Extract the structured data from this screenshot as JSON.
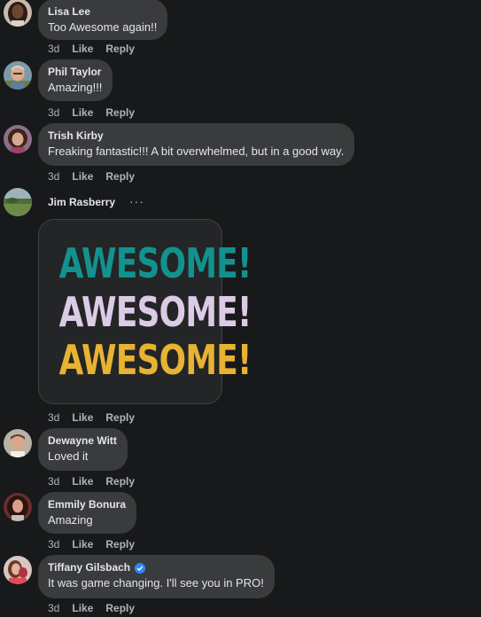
{
  "colors": {
    "background": "#18191a",
    "bubble": "#3a3b3c",
    "meta_text": "#b0b3b8",
    "verified_badge": "#2d88ff",
    "sticker_teal": "#12928f",
    "sticker_lavender": "#dccbe6",
    "sticker_gold": "#e8b232"
  },
  "comments": [
    {
      "author": "Lisa Lee",
      "text": "Too Awesome again!!",
      "time": "3d",
      "like": "Like",
      "reply": "Reply"
    },
    {
      "author": "Phil Taylor",
      "text": "Amazing!!!",
      "time": "3d",
      "like": "Like",
      "reply": "Reply"
    },
    {
      "author": "Trish Kirby",
      "text": "Freaking fantastic!!! A bit overwhelmed, but in a good way.",
      "time": "3d",
      "like": "Like",
      "reply": "Reply"
    },
    {
      "author": "Jim Rasberry",
      "more": "···",
      "sticker": [
        "AWESOME!",
        "AWESOME!",
        "AWESOME!"
      ],
      "time": "3d",
      "like": "Like",
      "reply": "Reply"
    },
    {
      "author": "Dewayne Witt",
      "text": "Loved it",
      "time": "3d",
      "like": "Like",
      "reply": "Reply"
    },
    {
      "author": "Emmily Bonura",
      "text": "Amazing",
      "time": "3d",
      "like": "Like",
      "reply": "Reply"
    },
    {
      "author": "Tiffany Gilsbach",
      "verified_icon": "verified-check-icon",
      "text": "It was game changing. I'll see you in PRO!",
      "time": "3d",
      "like": "Like",
      "reply": "Reply"
    }
  ]
}
